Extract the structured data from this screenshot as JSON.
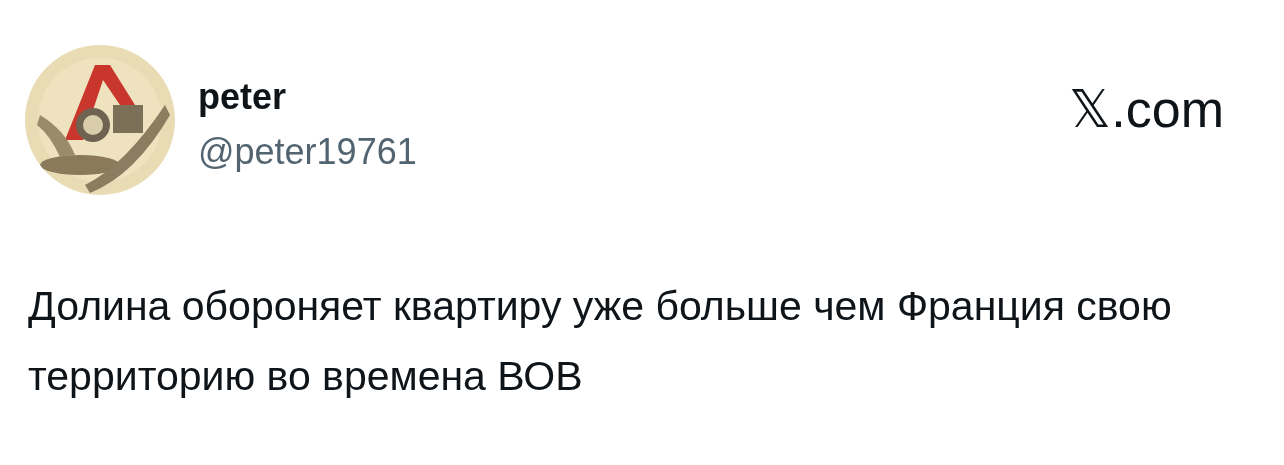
{
  "author": {
    "name": "peter",
    "handle": "@peter19761"
  },
  "source": "𝕏.com",
  "text": "Долина обороняет квартиру уже больше чем Франция свою территорию во времена ВОВ"
}
